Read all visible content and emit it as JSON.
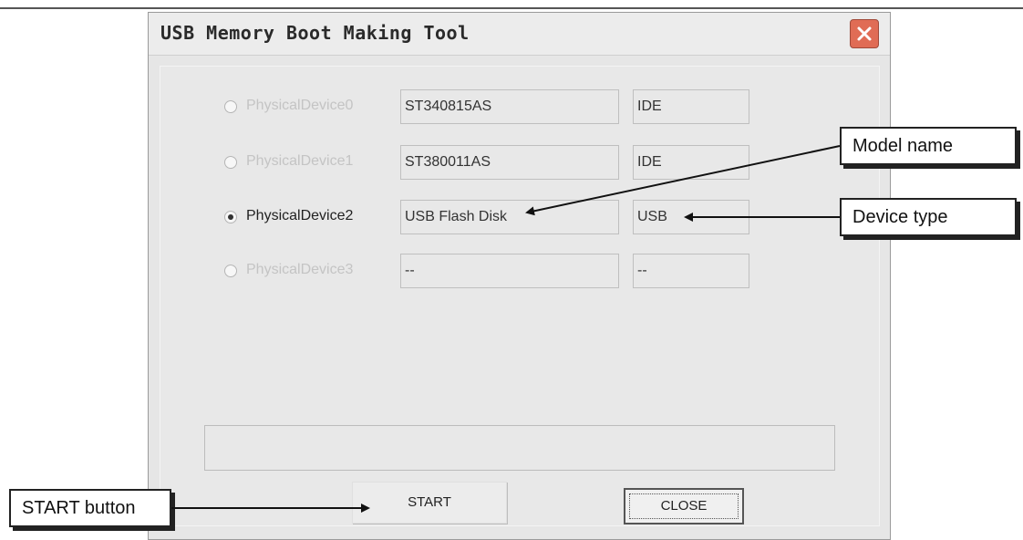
{
  "window": {
    "title": "USB Memory Boot Making Tool"
  },
  "devices": [
    {
      "label": "PhysicalDevice0",
      "model": "ST340815AS",
      "type": "IDE",
      "selected": false,
      "enabled": false
    },
    {
      "label": "PhysicalDevice1",
      "model": "ST380011AS",
      "type": "IDE",
      "selected": false,
      "enabled": false
    },
    {
      "label": "PhysicalDevice2",
      "model": "USB Flash Disk",
      "type": "USB",
      "selected": true,
      "enabled": true
    },
    {
      "label": "PhysicalDevice3",
      "model": "--",
      "type": "--",
      "selected": false,
      "enabled": false
    }
  ],
  "buttons": {
    "start": "START",
    "close": "CLOSE"
  },
  "callouts": {
    "model": "Model name",
    "type": "Device type",
    "start": "START button"
  },
  "colors": {
    "window_bg": "#e6e6e6",
    "close_button": "#e06c55"
  }
}
